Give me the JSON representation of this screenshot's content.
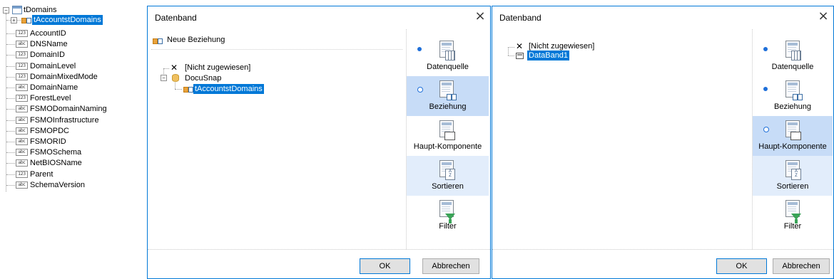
{
  "tree": {
    "root_label": "tDomains",
    "child_label": "tAccountstDomains",
    "fields": [
      {
        "type": "123",
        "name": "AccountID"
      },
      {
        "type": "abc",
        "name": "DNSName"
      },
      {
        "type": "123",
        "name": "DomainID"
      },
      {
        "type": "123",
        "name": "DomainLevel"
      },
      {
        "type": "123",
        "name": "DomainMixedMode"
      },
      {
        "type": "abc",
        "name": "DomainName"
      },
      {
        "type": "123",
        "name": "ForestLevel"
      },
      {
        "type": "abc",
        "name": "FSMODomainNaming"
      },
      {
        "type": "abc",
        "name": "FSMOInfrastructure"
      },
      {
        "type": "abc",
        "name": "FSMOPDC"
      },
      {
        "type": "abc",
        "name": "FSMORID"
      },
      {
        "type": "abc",
        "name": "FSMOSchema"
      },
      {
        "type": "abc",
        "name": "NetBIOSName"
      },
      {
        "type": "123",
        "name": "Parent"
      },
      {
        "type": "abc",
        "name": "SchemaVersion"
      }
    ]
  },
  "dialog1": {
    "title": "Datenband",
    "close": "×",
    "new_relation": "Neue Beziehung",
    "not_assigned": "[Nicht zugewiesen]",
    "source": "DocuSnap",
    "relation": "tAccountstDomains",
    "nav": [
      "Datenquelle",
      "Beziehung",
      "Haupt-Komponente",
      "Sortieren",
      "Filter"
    ],
    "ok": "OK",
    "cancel": "Abbrechen"
  },
  "dialog2": {
    "title": "Datenband",
    "close": "×",
    "not_assigned": "[Nicht zugewiesen]",
    "band": "DataBand1",
    "nav": [
      "Datenquelle",
      "Beziehung",
      "Haupt-Komponente",
      "Sortieren",
      "Filter"
    ],
    "ok": "OK",
    "cancel": "Abbrechen"
  },
  "colors": {
    "accent": "#0078d7",
    "nav_active": "#c7dcf7",
    "nav_light": "#e2edfb",
    "bullet": "#1e6fd9"
  }
}
